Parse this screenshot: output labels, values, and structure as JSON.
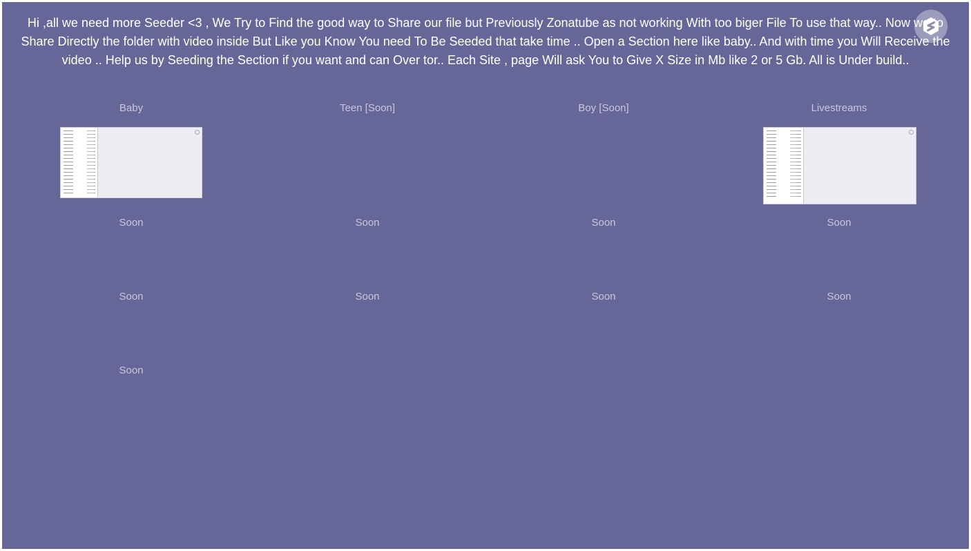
{
  "intro": {
    "text": "Hi ,all we need more Seeder <3 , We Try to Find the good way to Share our file but Previously Zonatube as not working With too biger File To use that way.. Now we to Share Directly the folder with video inside But Like you Know You need To Be Seeded that take time .. Open a Section here like baby.. And with time you Will Receive the video .. Help us by Seeding the Section if you want and can Over tor.. Each Site , page Will ask You to Give X Size in Mb like 2 or 5 Gb. All is Under build.."
  },
  "logo": {
    "icon": "hexagon-s-logo-icon"
  },
  "sections": [
    {
      "label": "Baby",
      "has_preview": true
    },
    {
      "label": "Teen [Soon]",
      "has_preview": false
    },
    {
      "label": "Boy [Soon]",
      "has_preview": false
    },
    {
      "label": "Livestreams",
      "has_preview": true
    }
  ],
  "placeholders": [
    "Soon",
    "Soon",
    "Soon",
    "Soon",
    "Soon",
    "Soon",
    "Soon",
    "Soon",
    "Soon"
  ],
  "colors": {
    "background": "#666699",
    "intro_text": "#ffffff",
    "label_text": "#c8c8dc"
  }
}
